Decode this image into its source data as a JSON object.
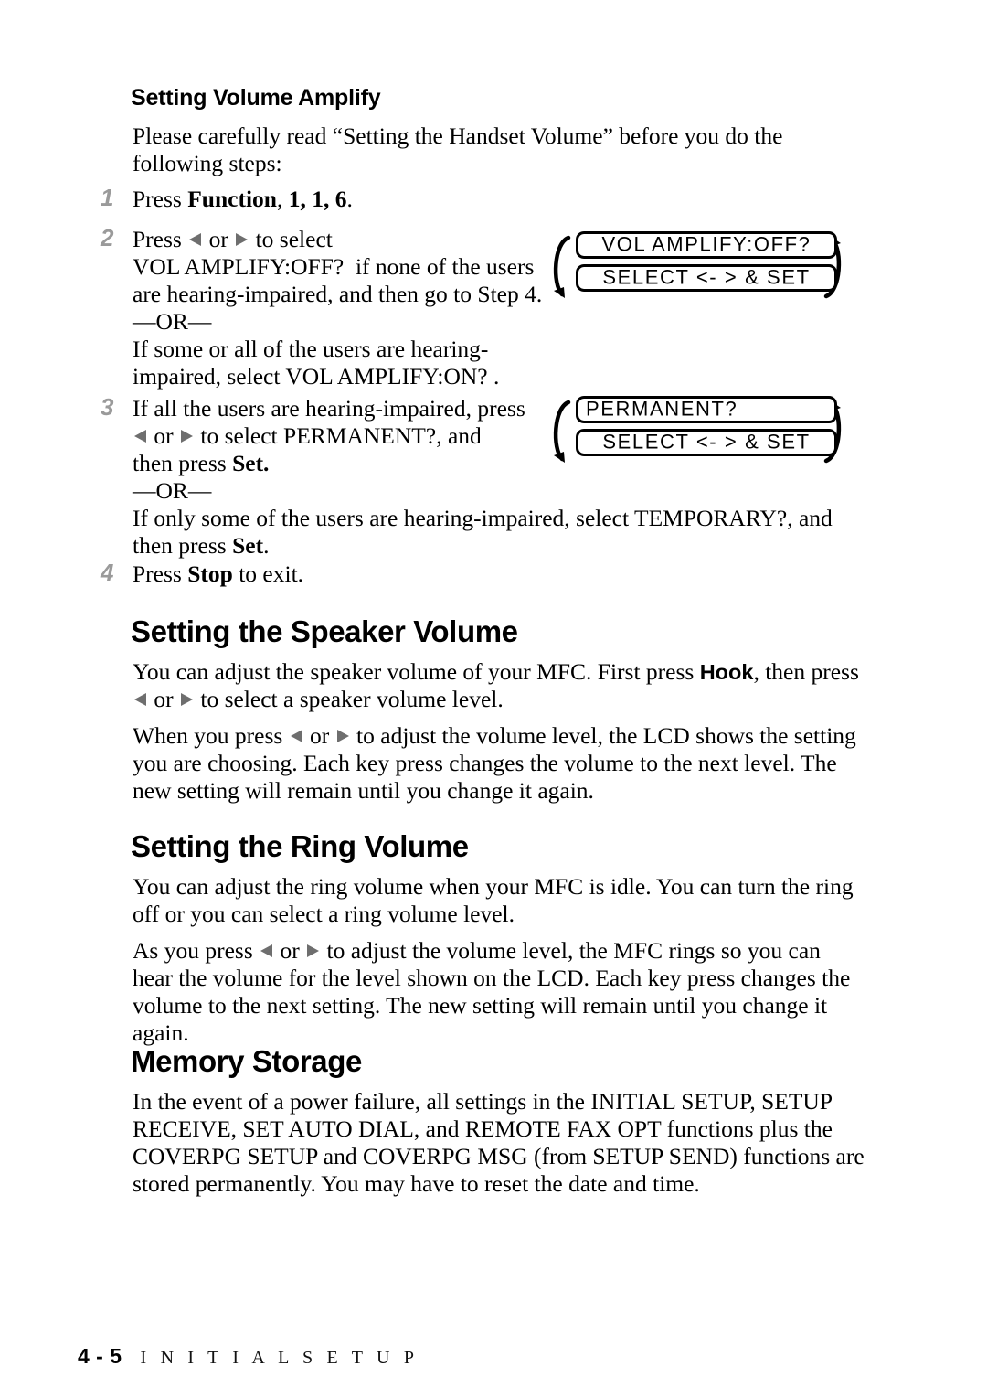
{
  "document": {
    "footer": {
      "page_number": "4 - 5",
      "chapter_title": "I N I T I A L   S E T U P"
    }
  },
  "sections": {
    "volume_amplify": {
      "heading": "Setting Volume Amplify",
      "intro": "Please carefully read “Setting the Handset Volume” before you do the following steps:",
      "steps": [
        {
          "number": "1",
          "prefix": "Press ",
          "key": "Function",
          "suffix_sep": ", ",
          "keys": "1, 1, 6",
          "end": "."
        },
        {
          "number": "2",
          "line1_a": "Press ",
          "line1_b": " or ",
          "line1_c": " to select",
          "line2": "VOL AMPLIFY:OFF?",
          "line2_tail": "if none of the users",
          "line3": "are hearing-impaired, and then go to Step 4.",
          "or": "—OR—",
          "line4": "If some or all of the users are hearing-",
          "line5_a": "impaired, select ",
          "line5_b": "VOL AMPLIFY:ON?",
          "line5_c": "."
        },
        {
          "number": "3",
          "line1": "If all the users are hearing-impaired, press",
          "line2_a": " or ",
          "line2_b": " to select ",
          "line2_c": "PERMANENT?",
          "line2_d": ", and",
          "line3_a": "then press ",
          "line3_b": "Set.",
          "or": "—OR—",
          "line4_a": "If only some of the users are hearing-impaired, select ",
          "line4_b": "TEMPORARY?",
          "line4_c": ", and",
          "line5_a": "then press ",
          "line5_b": "Set",
          "line5_c": "."
        },
        {
          "number": "4",
          "prefix": "Press ",
          "key": "Stop",
          "suffix": " to exit."
        }
      ],
      "lcd_displays": [
        {
          "line1": "VOL AMPLIFY:OFF?",
          "line2": "SELECT <- > & SET",
          "line1_align": "center"
        },
        {
          "line1": "PERMANENT?",
          "line2": "SELECT <- > & SET",
          "line1_align": "left"
        }
      ]
    },
    "speaker_volume": {
      "heading": "Setting the Speaker Volume",
      "p1_a": "You can adjust the speaker volume of your MFC. First press ",
      "p1_key": "Hook",
      "p1_b": ", then press",
      "p1_c": " or ",
      "p1_d": " to select a speaker volume level.",
      "p2_a": "When you press ",
      "p2_b": " or ",
      "p2_c": " to adjust the volume level, the LCD shows the setting you are choosing.  Each key press changes the volume to the next level. The new setting will remain until you change it again."
    },
    "ring_volume": {
      "heading": "Setting the Ring Volume",
      "p1": "You can adjust the ring volume when your MFC is idle. You can turn the ring off or you can select a ring volume level.",
      "p2_a": "As you press ",
      "p2_b": " or ",
      "p2_c": " to adjust the volume level, the MFC rings so you can hear the volume for the level shown on the LCD.  Each key press changes the volume to the next setting.  The new setting will remain until you change it again."
    },
    "memory_storage": {
      "heading": "Memory Storage",
      "p1": "In the event of a power failure, all settings in the INITIAL SETUP, SETUP RECEIVE, SET AUTO DIAL, and REMOTE FAX OPT functions plus the COVERPG SETUP and COVERPG MSG (from SETUP SEND) functions are stored permanently. You may have to reset the date and time."
    }
  },
  "colors": {
    "text": "#000000",
    "step_number": "#9a9a9a",
    "arrow_glyph": "#6e6e6e",
    "background": "#ffffff"
  }
}
